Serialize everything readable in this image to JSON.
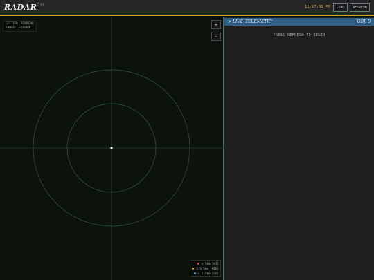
{
  "header": {
    "logo": "RADAR",
    "logo_sup": "???",
    "clock": "11:17:08 PM",
    "load_label": "LOAD",
    "refresh_label": "REFRESH"
  },
  "radar": {
    "sector_line": "SECTOR: PENDING",
    "range_line": "RANGE: ~100KM",
    "zoom_in_label": "+",
    "zoom_out_label": "-",
    "legend": [
      {
        "label": "> 5km [HI]",
        "color": "#e04848"
      },
      {
        "label": "2.5-5km [MID]",
        "color": "#e8a23a"
      },
      {
        "label": "< 2.5km [LO]",
        "color": "#4aa8e0"
      }
    ]
  },
  "telemetry": {
    "title": "> LIVE_TELEMETRY",
    "obj_count": "OBJ: 0",
    "message": "PRESS REFRESH TO BEGIN"
  },
  "colors": {
    "accent": "#c9a227",
    "panel_header": "#2f5f87",
    "grid": "#23402d"
  }
}
